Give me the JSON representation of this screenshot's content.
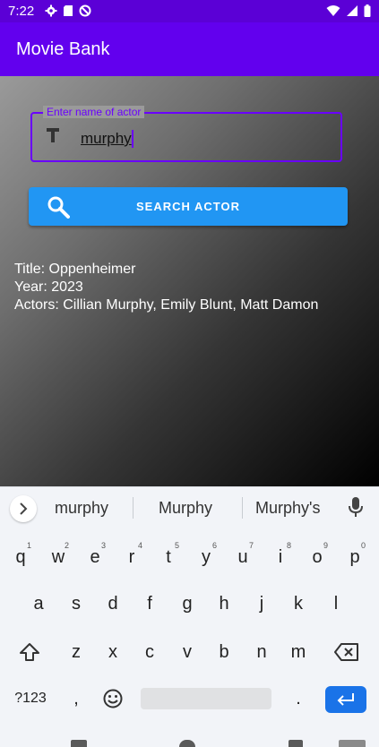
{
  "status_bar": {
    "time": "7:22",
    "icons": [
      "settings-icon",
      "sim-card-icon",
      "do-not-disturb-icon",
      "wifi-icon",
      "signal-icon",
      "battery-icon"
    ]
  },
  "app_bar": {
    "title": "Movie Bank"
  },
  "search": {
    "field_label": "Enter name of actor",
    "field_value": "murphy",
    "field_icon": "text-field-icon",
    "button_label": "SEARCH ACTOR",
    "button_icon": "search-icon"
  },
  "result": {
    "title_line": "Title: Oppenheimer",
    "year_line": "Year: 2023",
    "actors_line": "Actors: Cillian Murphy, Emily Blunt, Matt Damon"
  },
  "keyboard": {
    "suggestions": [
      "murphy",
      "Murphy",
      "Murphy's"
    ],
    "row1": [
      {
        "k": "q",
        "h": "1"
      },
      {
        "k": "w",
        "h": "2"
      },
      {
        "k": "e",
        "h": "3"
      },
      {
        "k": "r",
        "h": "4"
      },
      {
        "k": "t",
        "h": "5"
      },
      {
        "k": "y",
        "h": "6"
      },
      {
        "k": "u",
        "h": "7"
      },
      {
        "k": "i",
        "h": "8"
      },
      {
        "k": "o",
        "h": "9"
      },
      {
        "k": "p",
        "h": "0"
      }
    ],
    "row2": [
      "a",
      "s",
      "d",
      "f",
      "g",
      "h",
      "j",
      "k",
      "l"
    ],
    "row3": [
      "z",
      "x",
      "c",
      "v",
      "b",
      "n",
      "m"
    ],
    "symbols_key": "?123",
    "comma_key": ",",
    "period_key": "."
  },
  "colors": {
    "status_bar": "#5b00d6",
    "app_bar": "#6200ee",
    "accent": "#6a00ff",
    "button": "#2196f3",
    "enter_key": "#1a73e8"
  }
}
